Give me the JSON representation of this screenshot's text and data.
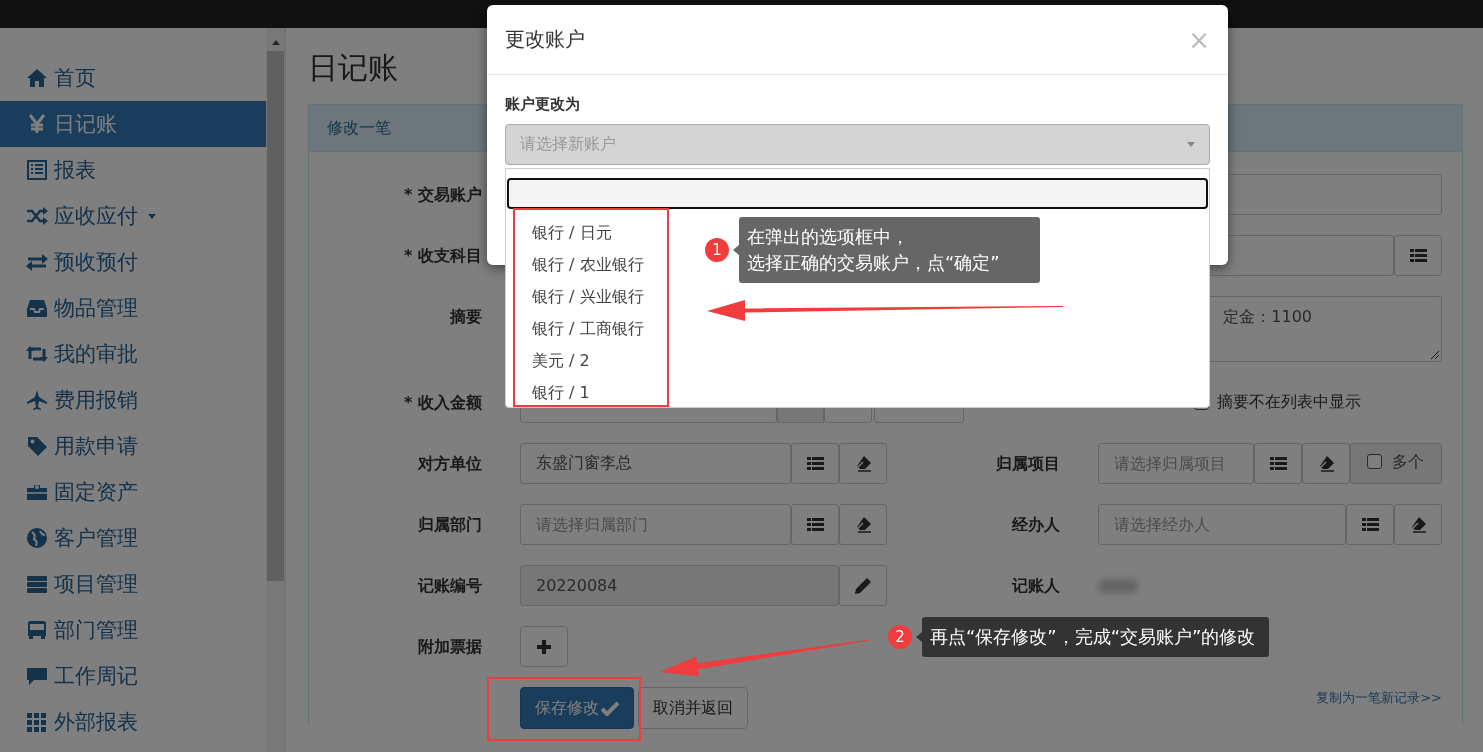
{
  "sidebar": {
    "items": [
      {
        "label": "首页",
        "selected": false
      },
      {
        "label": "日记账",
        "selected": true
      },
      {
        "label": "报表",
        "selected": false
      },
      {
        "label": "应收应付",
        "selected": false,
        "has_menu": true
      },
      {
        "label": "预收预付",
        "selected": false
      },
      {
        "label": "物品管理",
        "selected": false
      },
      {
        "label": "我的审批",
        "selected": false
      },
      {
        "label": "费用报销",
        "selected": false
      },
      {
        "label": "用款申请",
        "selected": false
      },
      {
        "label": "固定资产",
        "selected": false
      },
      {
        "label": "客户管理",
        "selected": false
      },
      {
        "label": "项目管理",
        "selected": false
      },
      {
        "label": "部门管理",
        "selected": false
      },
      {
        "label": "工作周记",
        "selected": false
      },
      {
        "label": "外部报表",
        "selected": false
      }
    ]
  },
  "page": {
    "title": "日记账"
  },
  "panel": {
    "title": "修改一笔"
  },
  "form": {
    "trade_account": {
      "label": "* 交易账户"
    },
    "category": {
      "label": "* 收支科目"
    },
    "summary": {
      "label": "摘要",
      "value": "定金：1100"
    },
    "income": {
      "label": "* 收入金额"
    },
    "summary_display": {
      "option": "摘要不在列表中显示",
      "checked": false
    },
    "counterparty": {
      "label": "对方单位",
      "value": "东盛门窗李总"
    },
    "project": {
      "label": "归属项目",
      "placeholder": "请选择归属项目",
      "multi_label": "多个",
      "multi_checked": false
    },
    "department": {
      "label": "归属部门",
      "placeholder": "请选择归属部门"
    },
    "handler": {
      "label": "经办人",
      "placeholder": "请选择经办人"
    },
    "voucher_no": {
      "label": "记账编号",
      "value": "20220084"
    },
    "bookkeeper": {
      "label": "记账人"
    },
    "attachments": {
      "label": "附加票据"
    },
    "buttons": [
      {
        "label": "保存修改",
        "kind": "primary"
      },
      {
        "label": "取消并返回",
        "kind": "default"
      }
    ],
    "copy_link": "复制为一笔新记录>>"
  },
  "modal": {
    "title": "更改账户",
    "close": "×",
    "field_label": "账户更改为",
    "select_placeholder": "请选择新账户",
    "options": [
      "银行 / 日元",
      "银行 / 农业银行",
      "银行 / 兴业银行",
      "银行 / 工商银行",
      "美元 / 2",
      "银行 / 1"
    ]
  },
  "annotations": [
    {
      "number": "1",
      "lines": [
        "在弹出的选项框中，",
        "选择正确的交易账户，点“确定”"
      ]
    },
    {
      "number": "2",
      "lines": [
        "再点“保存修改”，完成“交易账户”的修改"
      ]
    }
  ]
}
